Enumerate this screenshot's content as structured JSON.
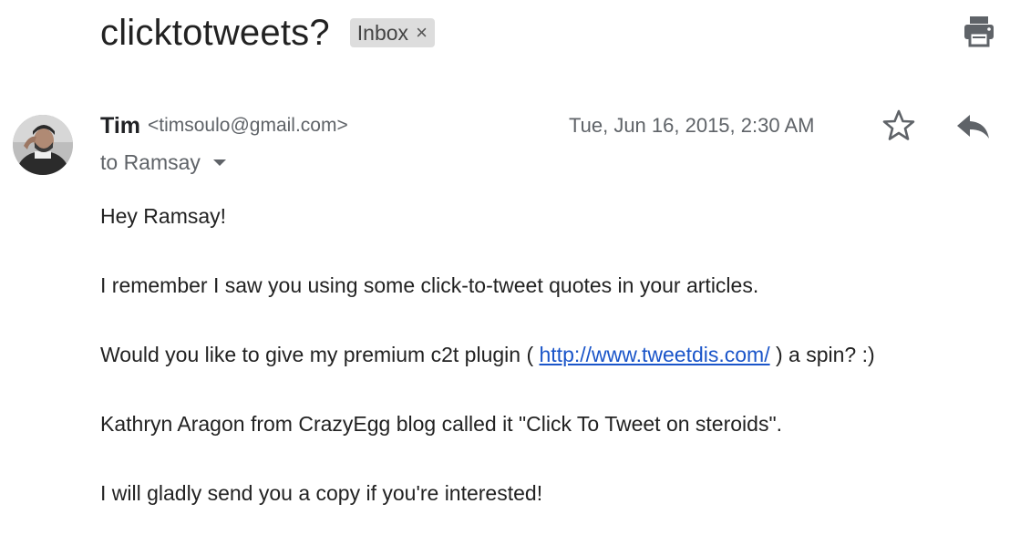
{
  "email": {
    "subject": "clicktotweets?",
    "label": "Inbox",
    "label_remove": "×"
  },
  "sender": {
    "name": "Tim",
    "email": "<timsoulo@gmail.com>",
    "recipient": "to Ramsay",
    "date": "Tue, Jun 16, 2015, 2:30 AM"
  },
  "body": {
    "greeting": "Hey Ramsay!",
    "line1": "I remember I saw you using some click-to-tweet quotes in your articles.",
    "line2_prefix": "Would you like to give my premium c2t plugin ( ",
    "line2_link": "http://www.tweetdis.com/",
    "line2_suffix": " ) a spin? :)",
    "line3": "Kathryn Aragon from CrazyEgg blog called it \"Click To Tweet on steroids\".",
    "line4": "I will gladly send you a copy if you're interested!"
  },
  "icons": {
    "print": "print-icon",
    "star": "star-icon",
    "reply": "reply-icon",
    "avatar": "avatar"
  },
  "colors": {
    "link": "#1a55c9",
    "label_chip": "#dddddd",
    "muted_text": "#5f6368"
  }
}
